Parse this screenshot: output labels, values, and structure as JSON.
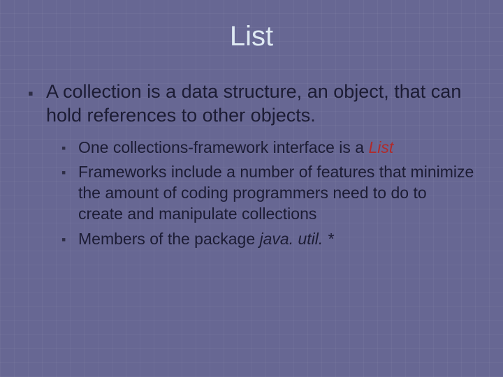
{
  "title": "List",
  "bullets": [
    {
      "text": "A collection is a data structure, an object, that can hold references to other objects.",
      "sub": [
        {
          "pre": "One collections-framework interface is a ",
          "em": "List",
          "emClass": "em-red"
        },
        {
          "pre": "Frameworks include a number of features that minimize the amount of coding programmers need to do to create and manipulate collections"
        },
        {
          "pre": "Members of the package ",
          "em": "java. util. *",
          "emClass": "em-it"
        }
      ]
    }
  ]
}
